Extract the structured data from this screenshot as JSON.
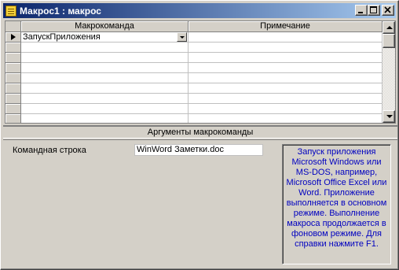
{
  "window": {
    "title": "Макрос1 : макрос"
  },
  "icons": {
    "app": "macro-icon",
    "minimize": "minimize-icon",
    "maximize": "maximize-icon",
    "close": "close-icon"
  },
  "grid": {
    "columns": [
      "Макрокоманда",
      "Примечание"
    ],
    "rows": [
      {
        "action": "ЗапускПриложения",
        "comment": "",
        "current": true
      },
      {
        "action": "",
        "comment": ""
      },
      {
        "action": "",
        "comment": ""
      },
      {
        "action": "",
        "comment": ""
      },
      {
        "action": "",
        "comment": ""
      },
      {
        "action": "",
        "comment": ""
      },
      {
        "action": "",
        "comment": ""
      },
      {
        "action": "",
        "comment": ""
      },
      {
        "action": "",
        "comment": ""
      }
    ]
  },
  "arguments": {
    "caption": "Аргументы макрокоманды",
    "command_line_label": "Командная строка",
    "command_line_value": "WinWord Заметки.doc"
  },
  "hint": {
    "text": "Запуск приложения Microsoft Windows или MS-DOS, например, Microsoft Office Excel или Word. Приложение выполняется в основном режиме. Выполнение макроса продолжается в фоновом режиме. Для справки нажмите F1."
  },
  "colors": {
    "titlebar_start": "#0a246a",
    "titlebar_end": "#a6caf0",
    "face": "#d4d0c8",
    "hint_text": "#0000c0"
  }
}
